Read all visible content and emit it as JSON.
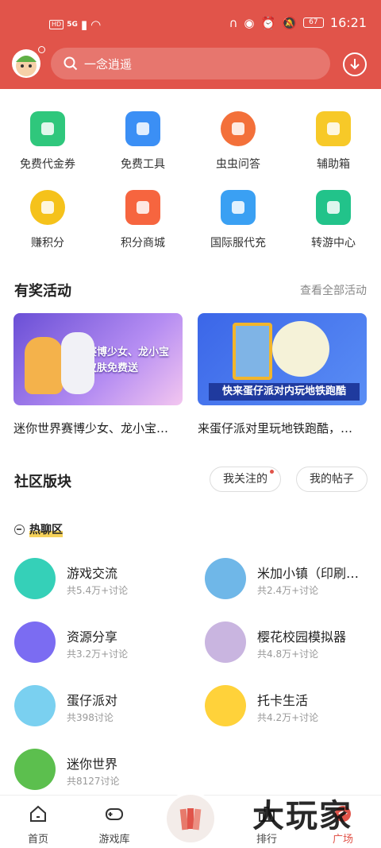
{
  "status": {
    "left_tags": [
      "HD",
      "5G"
    ],
    "battery": "67",
    "time": "16:21"
  },
  "header": {
    "search_placeholder": "一念逍遥"
  },
  "tools": [
    {
      "label": "免费代金券",
      "icon": "coupon-icon",
      "color": "#2fc77c"
    },
    {
      "label": "免费工具",
      "icon": "toolbox-icon",
      "color": "#3b8ff5"
    },
    {
      "label": "虫虫问答",
      "icon": "question-icon",
      "color": "#f3703a"
    },
    {
      "label": "辅助箱",
      "icon": "robot-icon",
      "color": "#f7c928"
    },
    {
      "label": "赚积分",
      "icon": "coin-icon",
      "color": "#f5c21b"
    },
    {
      "label": "积分商城",
      "icon": "shop-icon",
      "color": "#f6653f"
    },
    {
      "label": "国际服代充",
      "icon": "wallet-icon",
      "color": "#3aa0f3"
    },
    {
      "label": "转游中心",
      "icon": "transfer-icon",
      "color": "#22c38a"
    }
  ],
  "activities": {
    "title": "有奖活动",
    "more": "查看全部活动",
    "items": [
      {
        "banner_text": "赛博少女、龙小宝 皮肤免费送",
        "caption": "迷你世界赛博少女、龙小宝…"
      },
      {
        "banner_text": "快来蛋仔派对内玩地铁跑酷",
        "caption": "来蛋仔派对里玩地铁跑酷，…"
      }
    ]
  },
  "community": {
    "title": "社区版块",
    "follow": "我关注的",
    "posts": "我的帖子",
    "hot_label": "热聊区",
    "items": [
      {
        "name": "游戏交流",
        "meta": "共5.4万+讨论",
        "color": "#35d0b8"
      },
      {
        "name": "米加小镇（印刷…",
        "meta": "共2.4万+讨论",
        "color": "#6fb7e8"
      },
      {
        "name": "资源分享",
        "meta": "共3.2万+讨论",
        "color": "#7b6cf2"
      },
      {
        "name": "樱花校园模拟器",
        "meta": "共4.8万+讨论",
        "color": "#c9b5e0"
      },
      {
        "name": "蛋仔派对",
        "meta": "共398讨论",
        "color": "#7ad0f0"
      },
      {
        "name": "托卡生活",
        "meta": "共4.2万+讨论",
        "color": "#ffd23a"
      },
      {
        "name": "迷你世界",
        "meta": "共8127讨论",
        "color": "#5cbf4e"
      }
    ]
  },
  "nav": [
    {
      "label": "首页"
    },
    {
      "label": "游戏库"
    },
    {
      "label": "排行"
    },
    {
      "label": "广场"
    }
  ],
  "watermark": "大玩家"
}
